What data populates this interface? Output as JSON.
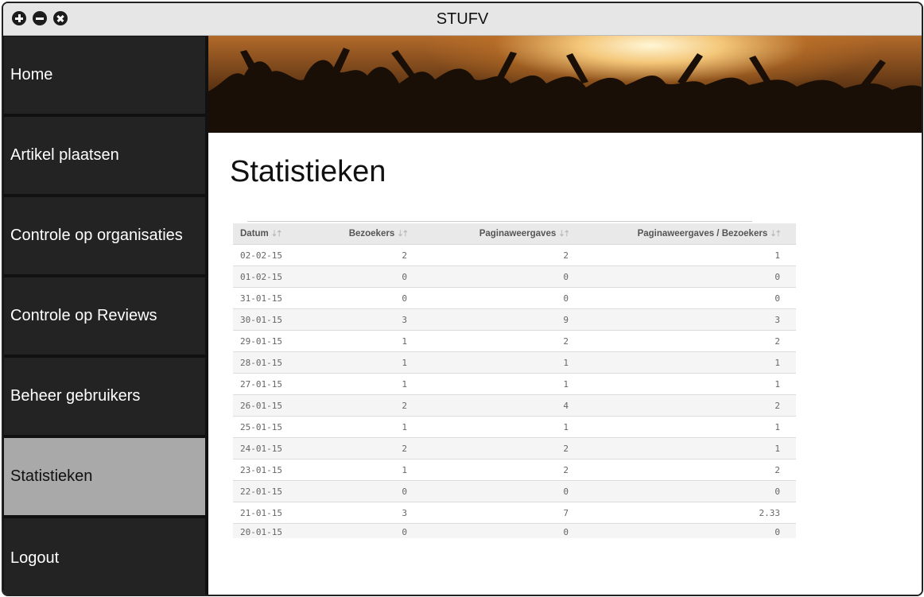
{
  "window": {
    "title": "STUFV"
  },
  "sidebar": {
    "items": [
      {
        "label": "Home",
        "active": false
      },
      {
        "label": "Artikel plaatsen",
        "active": false
      },
      {
        "label": "Controle op organisaties",
        "active": false
      },
      {
        "label": "Controle op Reviews",
        "active": false
      },
      {
        "label": "Beheer gebruikers",
        "active": false
      },
      {
        "label": "Statistieken",
        "active": true
      },
      {
        "label": "Logout",
        "active": false
      }
    ]
  },
  "main": {
    "heading": "Statistieken",
    "table": {
      "columns": [
        "Datum",
        "Bezoekers",
        "Paginaweergaves",
        "Paginaweergaves / Bezoekers"
      ],
      "sort_icon": "⇣⇡",
      "rows": [
        [
          "02-02-15",
          "2",
          "2",
          "1"
        ],
        [
          "01-02-15",
          "0",
          "0",
          "0"
        ],
        [
          "31-01-15",
          "0",
          "0",
          "0"
        ],
        [
          "30-01-15",
          "3",
          "9",
          "3"
        ],
        [
          "29-01-15",
          "1",
          "2",
          "2"
        ],
        [
          "28-01-15",
          "1",
          "1",
          "1"
        ],
        [
          "27-01-15",
          "1",
          "1",
          "1"
        ],
        [
          "26-01-15",
          "2",
          "4",
          "2"
        ],
        [
          "25-01-15",
          "1",
          "1",
          "1"
        ],
        [
          "24-01-15",
          "2",
          "2",
          "1"
        ],
        [
          "23-01-15",
          "1",
          "2",
          "2"
        ],
        [
          "22-01-15",
          "0",
          "0",
          "0"
        ],
        [
          "21-01-15",
          "3",
          "7",
          "2.33"
        ],
        [
          "20-01-15",
          "0",
          "0",
          "0"
        ]
      ]
    }
  },
  "colors": {
    "sidebar_item": "#232323",
    "sidebar_active": "#a9a9a9",
    "titlebar": "#e6e6e6"
  }
}
